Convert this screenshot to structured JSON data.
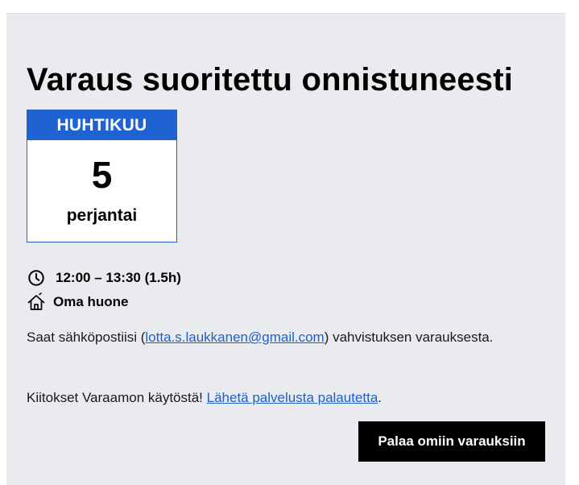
{
  "confirmation": {
    "title": "Varaus suoritettu onnistuneesti"
  },
  "calendar": {
    "month": "HUHTIKUU",
    "day": "5",
    "weekday": "perjantai",
    "header_color": "#1f62d2"
  },
  "details": {
    "time": "12:00 – 13:30 (1.5h)",
    "time_icon": "clock-icon",
    "room": "Oma huone",
    "room_icon": "house-icon"
  },
  "email_notice": {
    "prefix": "Saat sähköpostiisi (",
    "email": "lotta.s.laukkanen@gmail.com",
    "suffix": ") vahvistuksen varauksesta."
  },
  "feedback": {
    "text": "Kiitokset Varaamon käytöstä! ",
    "link_text": "Lähetä palvelusta palautetta",
    "end": "."
  },
  "actions": {
    "back_label": "Palaa omiin varauksiin"
  },
  "colors": {
    "card_background": "#eaebef",
    "link": "#1f5fc8",
    "button": "#000000"
  }
}
